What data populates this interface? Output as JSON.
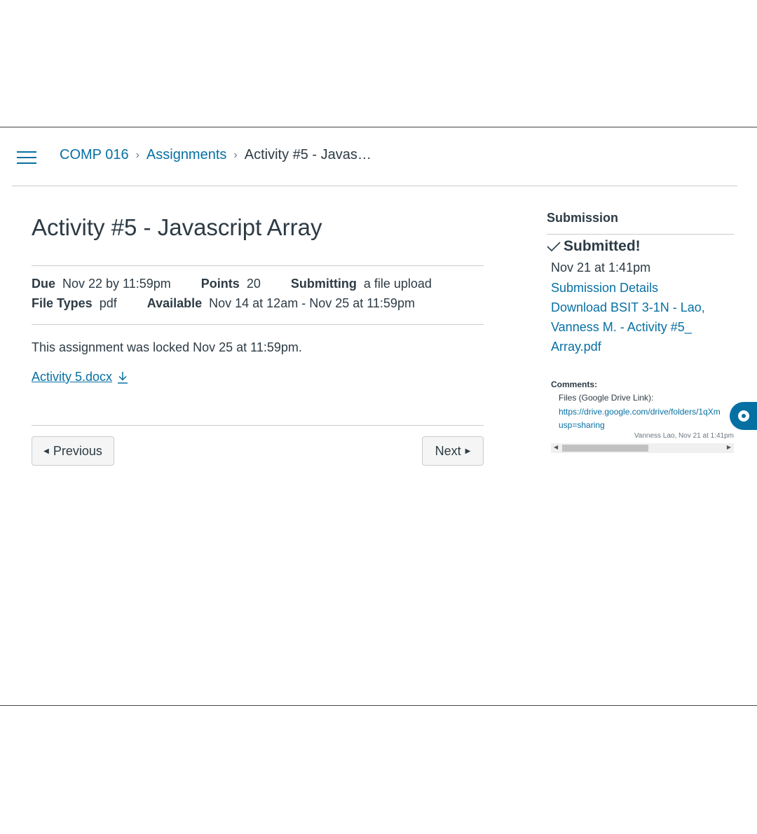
{
  "breadcrumb": {
    "course": "COMP 016",
    "section": "Assignments",
    "current": "Activity #5 - Javas…"
  },
  "assignment": {
    "title": "Activity #5 - Javascript Array",
    "due_label": "Due",
    "due_value": "Nov 22 by 11:59pm",
    "points_label": "Points",
    "points_value": "20",
    "submitting_label": "Submitting",
    "submitting_value": "a file upload",
    "filetypes_label": "File Types",
    "filetypes_value": "pdf",
    "available_label": "Available",
    "available_value": "Nov 14 at 12am - Nov 25 at 11:59pm",
    "locked_message": "This assignment was locked Nov 25 at 11:59pm.",
    "attachment_name": "Activity 5.docx"
  },
  "nav": {
    "previous": "Previous",
    "next": "Next"
  },
  "sidebar": {
    "heading": "Submission",
    "status": "Submitted!",
    "date": "Nov 21 at 1:41pm",
    "details_link": "Submission Details",
    "download_link_1": "Download BSIT 3-1N - Lao,",
    "download_link_2": "Vanness M. - Activity #5_",
    "download_link_3": "Array.pdf",
    "comments_heading": "Comments:",
    "comment_text": "Files (Google Drive Link):",
    "comment_url_1": "https://drive.google.com/drive/folders/1qXm",
    "comment_url_2": "usp=sharing",
    "comment_meta": "Vanness Lao, Nov 21 at 1:41pm"
  },
  "colors": {
    "link": "#0770a3",
    "text": "#2d3b45",
    "divider": "#c7cdd1"
  }
}
